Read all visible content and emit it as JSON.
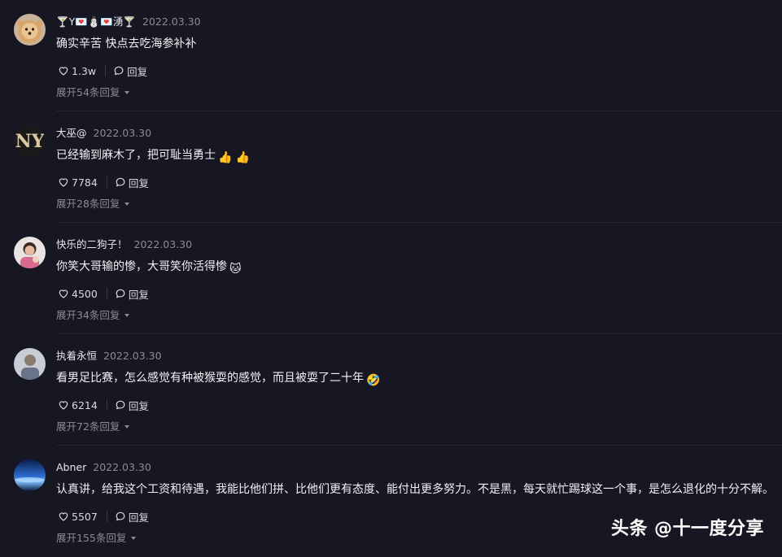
{
  "comments": [
    {
      "username": "🍸Y💌⛄💌湧🍸",
      "date": "2022.03.30",
      "text": "确实辛苦 快点去吃海参补补",
      "emoji": "",
      "likes": "1.3w",
      "reply_label": "回复",
      "expand_label": "展开54条回复"
    },
    {
      "username": "大巫@",
      "date": "2022.03.30",
      "text": "已经输到麻木了，把可耻当勇士",
      "emoji": "👍 👍",
      "likes": "7784",
      "reply_label": "回复",
      "expand_label": "展开28条回复"
    },
    {
      "username": "快乐的二狗子！",
      "date": "2022.03.30",
      "text": "你笑大哥输的惨，大哥笑你活得惨",
      "emoji": "🐱",
      "likes": "4500",
      "reply_label": "回复",
      "expand_label": "展开34条回复"
    },
    {
      "username": "执着永恒",
      "date": "2022.03.30",
      "text": "看男足比赛，怎么感觉有种被猴耍的感觉，而且被耍了二十年",
      "emoji": "🤣",
      "likes": "6214",
      "reply_label": "回复",
      "expand_label": "展开72条回复"
    },
    {
      "username": "Abner",
      "date": "2022.03.30",
      "text": "认真讲，给我这个工资和待遇，我能比他们拼、比他们更有态度、能付出更多努力。不是黑，每天就忙踢球这一个事，是怎么退化的十分不解。",
      "emoji": "",
      "likes": "5507",
      "reply_label": "回复",
      "expand_label": "展开155条回复"
    }
  ],
  "watermark": "头条 @十一度分享"
}
